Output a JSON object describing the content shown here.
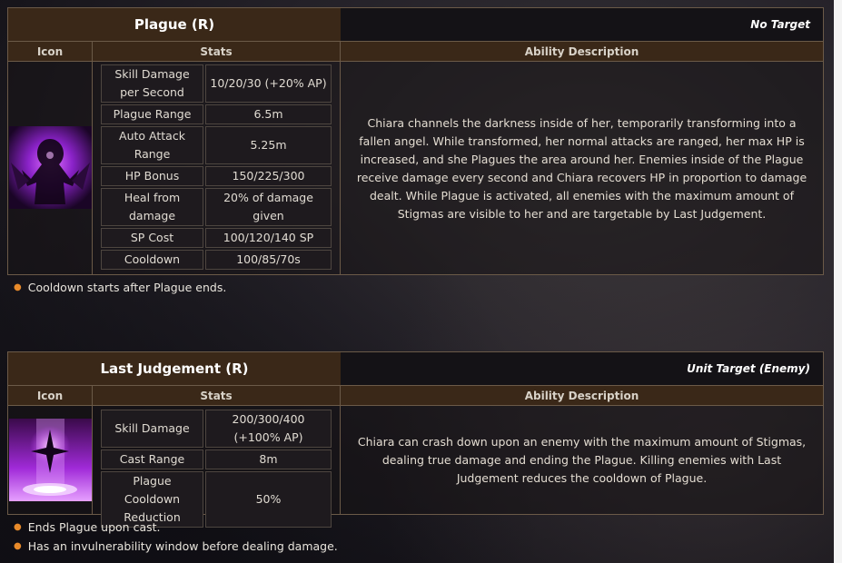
{
  "skills": [
    {
      "title": "Plague (R)",
      "target": "No Target",
      "headers": {
        "icon": "Icon",
        "stats": "Stats",
        "desc": "Ability Description"
      },
      "stats": [
        {
          "label": "Skill Damage per Second",
          "value": "10/20/30 (+20% AP)"
        },
        {
          "label": "Plague Range",
          "value": "6.5m"
        },
        {
          "label": "Auto Attack Range",
          "value": "5.25m"
        },
        {
          "label": "HP Bonus",
          "value": "150/225/300"
        },
        {
          "label": "Heal from damage",
          "value": "20% of damage given"
        },
        {
          "label": "SP Cost",
          "value": "100/120/140 SP"
        },
        {
          "label": "Cooldown",
          "value": "100/85/70s"
        }
      ],
      "description": "Chiara channels the darkness inside of her, temporarily transforming into a fallen angel. While transformed, her normal attacks are ranged, her max HP is increased, and she Plagues the area around her. Enemies inside of the Plague receive damage every second and Chiara recovers HP in proportion to damage dealt. While Plague is activated, all enemies with the maximum amount of Stigmas are visible to her and are targetable by Last Judgement.",
      "notes": [
        "Cooldown starts after Plague ends."
      ],
      "icon": "plague-icon"
    },
    {
      "title": "Last Judgement (R)",
      "target": "Unit Target (Enemy)",
      "headers": {
        "icon": "Icon",
        "stats": "Stats",
        "desc": "Ability Description"
      },
      "stats": [
        {
          "label": "Skill Damage",
          "value": "200/300/400 (+100% AP)"
        },
        {
          "label": "Cast Range",
          "value": "8m"
        },
        {
          "label": "Plague Cooldown Reduction",
          "value": "50%"
        }
      ],
      "description": "Chiara can crash down upon an enemy with the maximum amount of Stigmas, dealing true damage and ending the Plague. Killing enemies with Last Judgement reduces the cooldown of Plague.",
      "notes": [
        "Ends Plague upon cast.",
        "Has an invulnerability window before dealing damage."
      ],
      "icon": "last-judgement-icon"
    }
  ],
  "colors": {
    "header_bg": "#3a2818",
    "border": "#6b5a48",
    "bullet": "#e88a2a",
    "accent_magenta": "#c43cff"
  }
}
